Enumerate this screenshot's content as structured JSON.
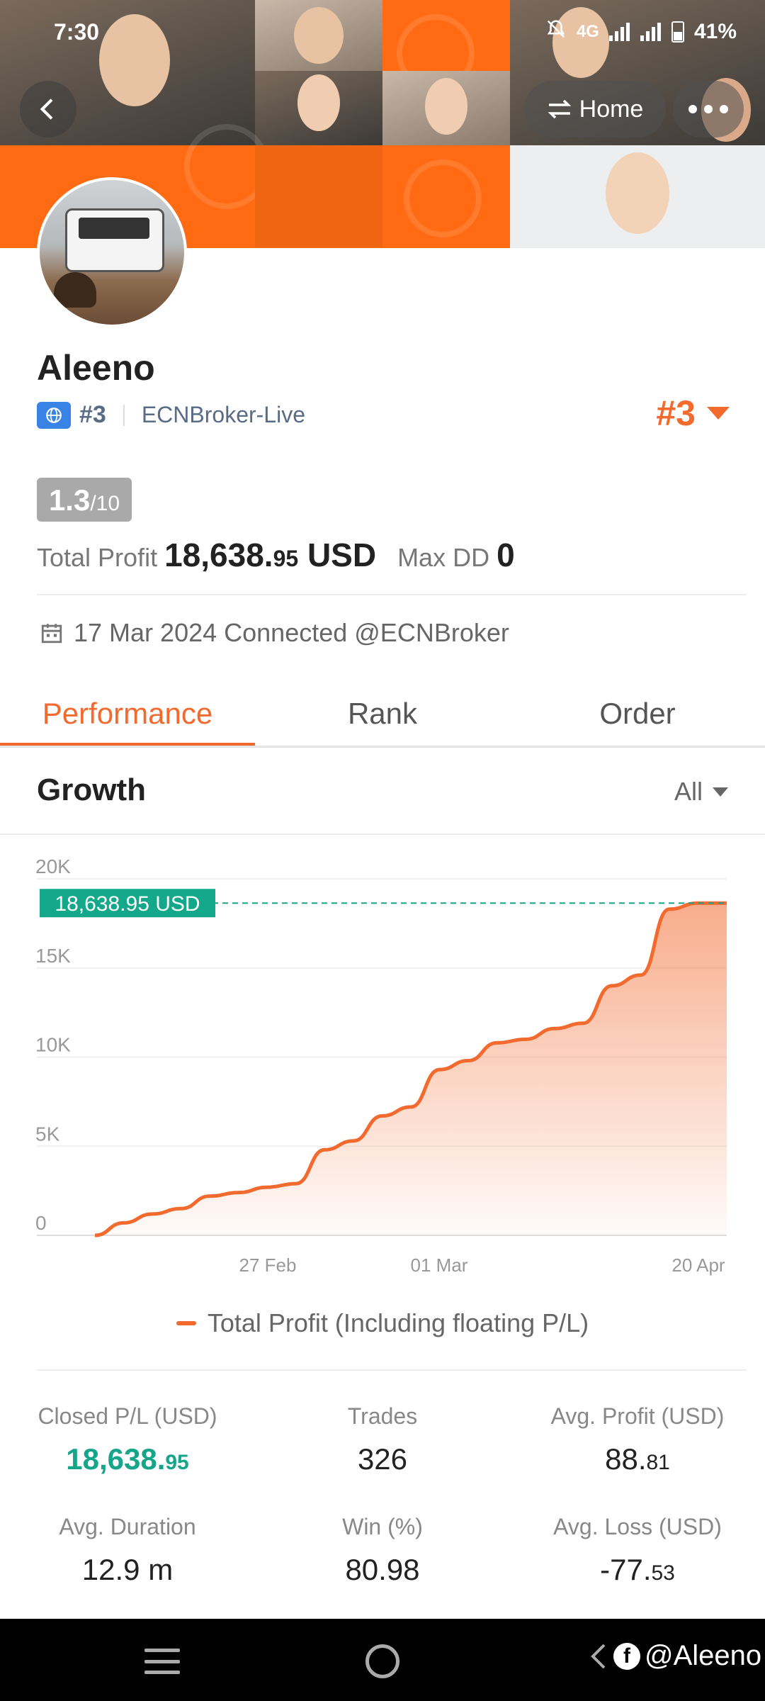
{
  "status_bar": {
    "time": "7:30",
    "network_label": "4G",
    "battery": "41%"
  },
  "header": {
    "home_label": "Home"
  },
  "profile": {
    "name": "Aleeno",
    "rank_small": "#3",
    "broker": "ECNBroker-Live",
    "rank_big": "#3",
    "score": "1.3",
    "score_max": "/10",
    "total_profit_label": "Total Profit",
    "total_profit_main": "18,638.",
    "total_profit_decimals": "95",
    "total_profit_unit": "USD",
    "max_dd_label": "Max DD",
    "max_dd_value": "0",
    "connected_text": "17 Mar 2024 Connected @ECNBroker"
  },
  "tabs": [
    {
      "label": "Performance",
      "active": true
    },
    {
      "label": "Rank",
      "active": false
    },
    {
      "label": "Order",
      "active": false
    }
  ],
  "growth": {
    "title": "Growth",
    "filter": "All"
  },
  "chart_data": {
    "type": "area",
    "title": "",
    "xlabel": "",
    "ylabel": "",
    "ylim": [
      0,
      20000
    ],
    "y_ticks": [
      "0",
      "5K",
      "10K",
      "15K",
      "20K"
    ],
    "x_ticks": [
      "27 Feb",
      "01 Mar",
      "20 Apr"
    ],
    "highlight_label": "18,638.95 USD",
    "highlight_value": 18638.95,
    "series": [
      {
        "name": "Total Profit (Including floating P/L)",
        "color": "#f26a2e",
        "values": [
          0,
          700,
          1200,
          1500,
          2200,
          2400,
          2700,
          2900,
          4800,
          5300,
          6700,
          7200,
          9300,
          9800,
          10800,
          11000,
          11600,
          11900,
          14000,
          14600,
          18300,
          18638.95,
          18638.95
        ]
      }
    ]
  },
  "legend": {
    "label": "Total Profit (Including floating P/L)"
  },
  "stats": {
    "closed_pl_label": "Closed P/L (USD)",
    "closed_pl_main": "18,638.",
    "closed_pl_dec": "95",
    "trades_label": "Trades",
    "trades_value": "326",
    "avg_profit_label": "Avg. Profit (USD)",
    "avg_profit_main": "88.",
    "avg_profit_dec": "81",
    "avg_duration_label": "Avg. Duration",
    "avg_duration_value": "12.9 m",
    "win_label": "Win (%)",
    "win_value": "80.98",
    "avg_loss_label": "Avg. Loss (USD)",
    "avg_loss_main": "-77.",
    "avg_loss_dec": "53"
  },
  "nav": {
    "watermark": "@Aleeno"
  }
}
